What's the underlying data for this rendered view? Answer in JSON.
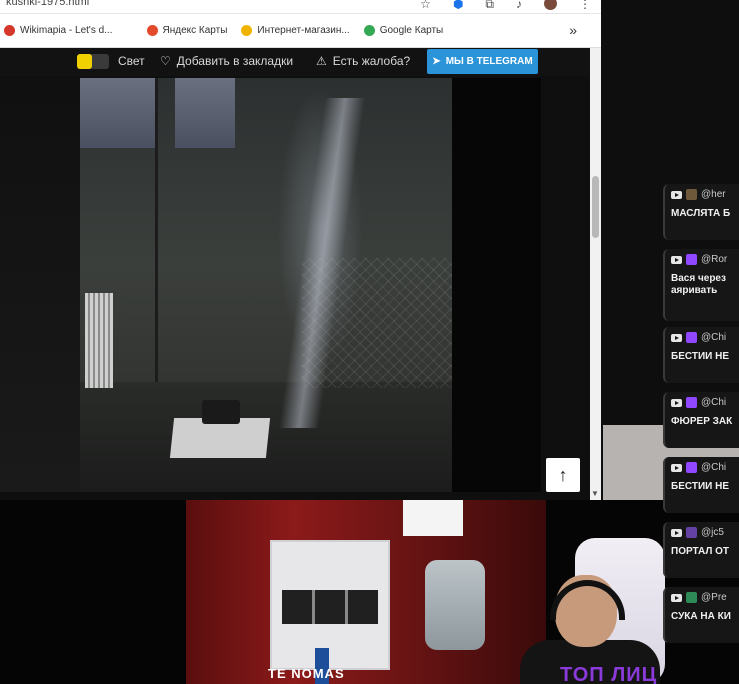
{
  "browser": {
    "url": "kushki-1975.html",
    "bookmarks": [
      {
        "label": "Wikimapia - Let's d...",
        "color": "#d4382c"
      },
      {
        "label": "Яндекс Карты",
        "color": "#e24a2b"
      },
      {
        "label": "Интернет-магазин...",
        "color": "#f0b400"
      },
      {
        "label": "Google Карты",
        "color": "#34a853"
      }
    ],
    "more": "»"
  },
  "site": {
    "light_label": "Свет",
    "bookmark_label": "Добавить в закладки",
    "complaint_label": "Есть жалоба?",
    "telegram_label": "МЫ В TELEGRAM",
    "scroll_top_icon": "↑"
  },
  "stream": {
    "overlay_text": "ТОП ЛИЦ",
    "brand_text": "TE NOMAS"
  },
  "chat": {
    "messages": [
      {
        "user": "@her",
        "text": "МАСЛЯТА Б",
        "badge_color": "#6e5a3a"
      },
      {
        "user": "@Ror",
        "text": "Вася через\nаяривать",
        "badge_color": "#9146ff"
      },
      {
        "user": "@Chi",
        "text": "БЕСТИИ НЕ",
        "badge_color": "#9146ff"
      },
      {
        "user": "@Chi",
        "text": "ФЮРЕР ЗАК",
        "badge_color": "#9146ff"
      },
      {
        "user": "@Chi",
        "text": "БЕСТИИ НЕ",
        "badge_color": "#9146ff"
      },
      {
        "user": "@jc5",
        "text": "ПОРТАЛ ОТ",
        "badge_color": "#6441a5"
      },
      {
        "user": "@Pre",
        "text": "СУКА НА КИ",
        "badge_color": "#2e8b57"
      }
    ]
  }
}
